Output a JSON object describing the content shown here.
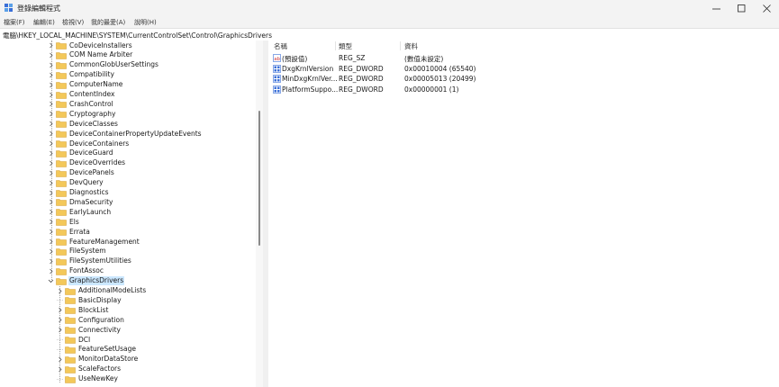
{
  "window": {
    "title": "登錄編輯程式",
    "controls": [
      "minimize-icon",
      "maximize-icon",
      "close-icon"
    ]
  },
  "menu": [
    "檔案(F)",
    "編輯(E)",
    "檢視(V)",
    "我的最愛(A)",
    "說明(H)"
  ],
  "address": "電腦\\HKEY_LOCAL_MACHINE\\SYSTEM\\CurrentControlSet\\Control\\GraphicsDrivers",
  "tree": {
    "items": [
      {
        "label": "CoDeviceInstallers",
        "expandable": true
      },
      {
        "label": "COM Name Arbiter",
        "expandable": true
      },
      {
        "label": "CommonGlobUserSettings",
        "expandable": true
      },
      {
        "label": "Compatibility",
        "expandable": true
      },
      {
        "label": "ComputerName",
        "expandable": true
      },
      {
        "label": "ContentIndex",
        "expandable": true
      },
      {
        "label": "CrashControl",
        "expandable": true
      },
      {
        "label": "Cryptography",
        "expandable": true
      },
      {
        "label": "DeviceClasses",
        "expandable": true
      },
      {
        "label": "DeviceContainerPropertyUpdateEvents",
        "expandable": true
      },
      {
        "label": "DeviceContainers",
        "expandable": true
      },
      {
        "label": "DeviceGuard",
        "expandable": true
      },
      {
        "label": "DeviceOverrides",
        "expandable": true
      },
      {
        "label": "DevicePanels",
        "expandable": true
      },
      {
        "label": "DevQuery",
        "expandable": true
      },
      {
        "label": "Diagnostics",
        "expandable": true
      },
      {
        "label": "DmaSecurity",
        "expandable": true
      },
      {
        "label": "EarlyLaunch",
        "expandable": true
      },
      {
        "label": "Els",
        "expandable": true
      },
      {
        "label": "Errata",
        "expandable": true
      },
      {
        "label": "FeatureManagement",
        "expandable": true
      },
      {
        "label": "FileSystem",
        "expandable": true
      },
      {
        "label": "FileSystemUtilities",
        "expandable": true
      },
      {
        "label": "FontAssoc",
        "expandable": true
      },
      {
        "label": "GraphicsDrivers",
        "expanded": true,
        "selected": true
      },
      {
        "label": "AdditionalModeLists",
        "child": true,
        "expandable": true
      },
      {
        "label": "BasicDisplay",
        "child": true,
        "expandable": false
      },
      {
        "label": "BlockList",
        "child": true,
        "expandable": true
      },
      {
        "label": "Configuration",
        "child": true,
        "expandable": true
      },
      {
        "label": "Connectivity",
        "child": true,
        "expandable": true
      },
      {
        "label": "DCI",
        "child": true,
        "expandable": false
      },
      {
        "label": "FeatureSetUsage",
        "child": true,
        "expandable": false
      },
      {
        "label": "MonitorDataStore",
        "child": true,
        "expandable": true
      },
      {
        "label": "ScaleFactors",
        "child": true,
        "expandable": true
      },
      {
        "label": "UseNewKey",
        "child": true,
        "expandable": false
      }
    ]
  },
  "values": {
    "columns": [
      "名稱",
      "類型",
      "資料"
    ],
    "rows": [
      {
        "name": "(預設值)",
        "type": "REG_SZ",
        "data": "(數值未設定)",
        "icon": "string-value-icon"
      },
      {
        "name": "DxgKrnlVersion",
        "type": "REG_DWORD",
        "data": "0x00010004 (65540)",
        "icon": "binary-value-icon"
      },
      {
        "name": "MinDxgKrnlVer...",
        "type": "REG_DWORD",
        "data": "0x00005013 (20499)",
        "icon": "binary-value-icon"
      },
      {
        "name": "PlatformSuppo...",
        "type": "REG_DWORD",
        "data": "0x00000001 (1)",
        "icon": "binary-value-icon"
      }
    ]
  },
  "colors": {
    "selection": "#cce8ff",
    "folder": "#f3c85a",
    "value_icon_blue": "#3a6fd8",
    "value_icon_red": "#d13438"
  }
}
